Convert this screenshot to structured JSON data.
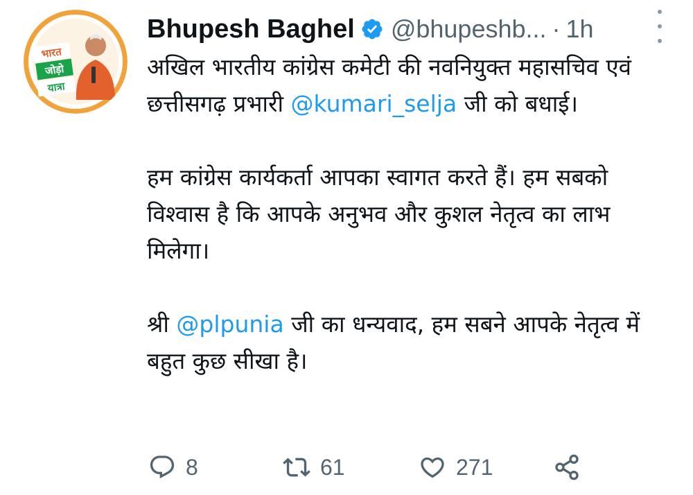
{
  "author": {
    "name": "Bhupesh Baghel",
    "handle": "@bhupeshb...",
    "separator": "·",
    "time": "1h",
    "avatar_text": {
      "line1": "भारत",
      "line2": "जोड़ो",
      "line3": "यात्रा"
    }
  },
  "tweet": {
    "p1_text": "अखिल भारतीय कांग्रेस कमेटी की नवनियुक्त महासचिव एवं छत्तीसगढ़ प्रभारी ",
    "p1_mention": "@kumari_selja",
    "p1_end": " जी को बधाई।",
    "p2": "हम कांग्रेस कार्यकर्ता आपका स्वागत करते हैं। हम सबको विश्वास है कि आपके अनुभव और कुशल नेतृत्व का लाभ मिलेगा।",
    "p3_start": "श्री ",
    "p3_mention": "@plpunia",
    "p3_end": " जी का धन्यवाद, हम सबने आपके नेतृत्व में बहुत कुछ सीखा है।"
  },
  "actions": {
    "replies": "8",
    "retweets": "61",
    "likes": "271"
  },
  "icons": [
    "verified-icon",
    "more-icon",
    "reply-icon",
    "retweet-icon",
    "like-icon",
    "share-icon"
  ],
  "colors": {
    "mention": "#1d9bf0",
    "verified": "#1d9bf0",
    "secondary": "#536471",
    "avatar_ring": "#f2a23a",
    "avatar_badge": "#1aa34a"
  }
}
